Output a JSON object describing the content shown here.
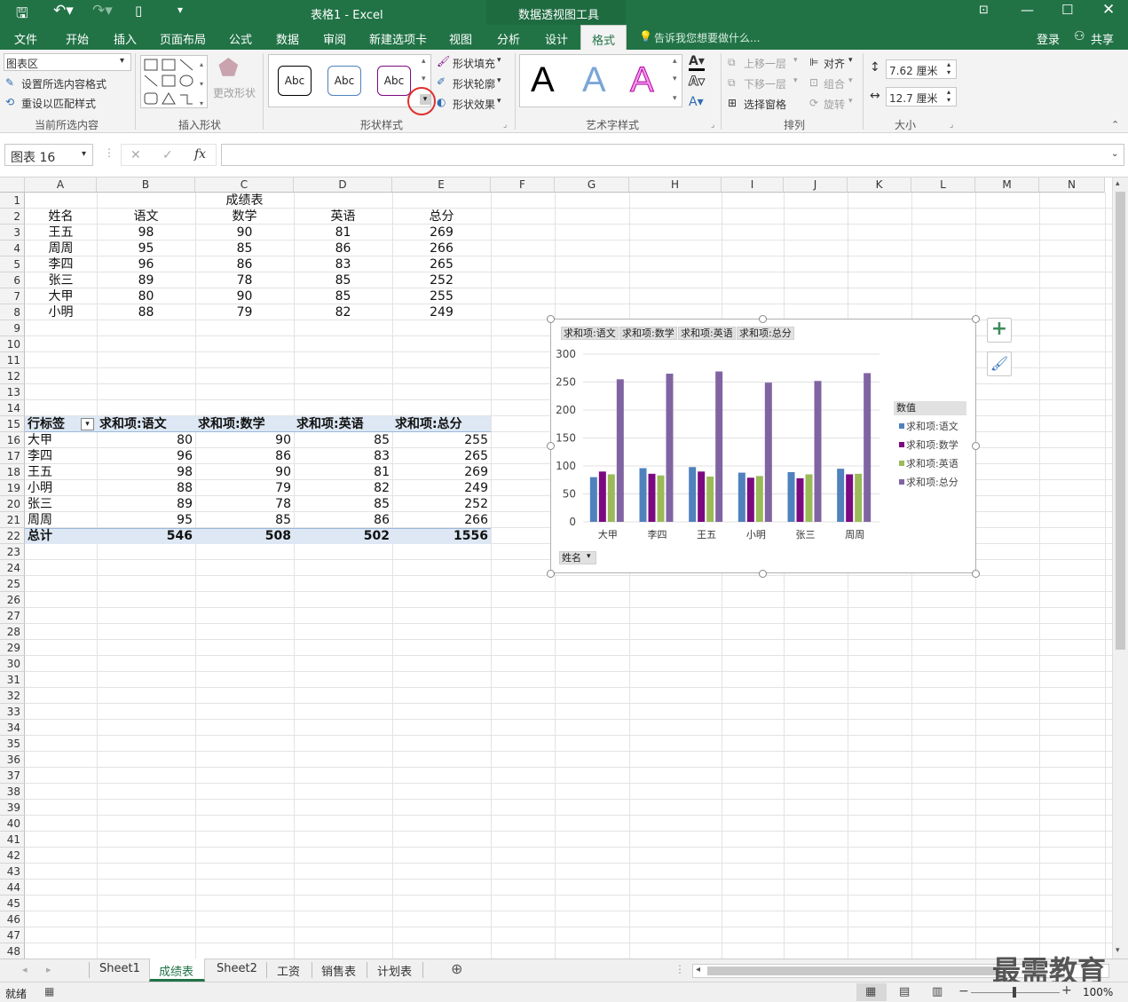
{
  "titlebar": {
    "title": "表格1 - Excel",
    "context_tool": "数据透视图工具"
  },
  "tabs": [
    "文件",
    "开始",
    "插入",
    "页面布局",
    "公式",
    "数据",
    "审阅",
    "新建选项卡",
    "视图",
    "分析",
    "设计",
    "格式"
  ],
  "tell_me": "告诉我您想要做什么...",
  "login": "登录",
  "share": "共享",
  "ribbon": {
    "selection_dropdown": "图表区",
    "format_selection": "设置所选内容格式",
    "reset_style": "重设以匹配样式",
    "group_current": "当前所选内容",
    "change_shape": "更改形状",
    "group_insert_shapes": "插入形状",
    "style_sample": "Abc",
    "shape_fill": "形状填充",
    "shape_outline": "形状轮廓",
    "shape_effects": "形状效果",
    "group_shape_styles": "形状样式",
    "wordart_letter": "A",
    "group_wordart": "艺术字样式",
    "bring_forward": "上移一层",
    "send_backward": "下移一层",
    "selection_pane": "选择窗格",
    "align": "对齐",
    "group": "组合",
    "rotate": "旋转",
    "group_arrange": "排列",
    "height": "7.62 厘米",
    "width": "12.7 厘米",
    "group_size": "大小"
  },
  "formula": {
    "namebox": "图表 16",
    "fx": "fx",
    "content": ""
  },
  "columns": [
    "A",
    "B",
    "C",
    "D",
    "E",
    "F",
    "G",
    "H",
    "I",
    "J",
    "K",
    "L",
    "M",
    "N"
  ],
  "table": {
    "title": "成绩表",
    "headers": [
      "姓名",
      "语文",
      "数学",
      "英语",
      "总分"
    ],
    "rows": [
      [
        "王五",
        "98",
        "90",
        "81",
        "269"
      ],
      [
        "周周",
        "95",
        "85",
        "86",
        "266"
      ],
      [
        "李四",
        "96",
        "86",
        "83",
        "265"
      ],
      [
        "张三",
        "89",
        "78",
        "85",
        "252"
      ],
      [
        "大甲",
        "80",
        "90",
        "85",
        "255"
      ],
      [
        "小明",
        "88",
        "79",
        "82",
        "249"
      ]
    ]
  },
  "pivot": {
    "headers": [
      "行标签",
      "求和项:语文",
      "求和项:数学",
      "求和项:英语",
      "求和项:总分"
    ],
    "rows": [
      [
        "大甲",
        "80",
        "90",
        "85",
        "255"
      ],
      [
        "李四",
        "96",
        "86",
        "83",
        "265"
      ],
      [
        "王五",
        "98",
        "90",
        "81",
        "269"
      ],
      [
        "小明",
        "88",
        "79",
        "82",
        "249"
      ],
      [
        "张三",
        "89",
        "78",
        "85",
        "252"
      ],
      [
        "周周",
        "95",
        "85",
        "86",
        "266"
      ]
    ],
    "total": [
      "总计",
      "546",
      "508",
      "502",
      "1556"
    ]
  },
  "chart_data": {
    "type": "bar",
    "categories": [
      "大甲",
      "李四",
      "王五",
      "小明",
      "张三",
      "周周"
    ],
    "series": [
      {
        "name": "求和项:语文",
        "values": [
          80,
          96,
          98,
          88,
          89,
          95
        ],
        "color": "#4f81bd"
      },
      {
        "name": "求和项:数学",
        "values": [
          90,
          86,
          90,
          79,
          78,
          85
        ],
        "color": "#7b0a81"
      },
      {
        "name": "求和项:英语",
        "values": [
          85,
          83,
          81,
          82,
          85,
          86
        ],
        "color": "#9bbb59"
      },
      {
        "name": "求和项:总分",
        "values": [
          255,
          265,
          269,
          249,
          252,
          266
        ],
        "color": "#8064a2"
      }
    ],
    "yticks": [
      "300",
      "250",
      "200",
      "150",
      "100",
      "50",
      "0"
    ],
    "ylim": [
      0,
      300
    ],
    "legend_title": "数值",
    "legend_position": "right",
    "axis_field": "姓名"
  },
  "sheets": [
    "Sheet1",
    "成绩表",
    "Sheet2",
    "工资",
    "销售表",
    "计划表"
  ],
  "status": {
    "ready": "就绪",
    "zoom": "100%"
  },
  "watermark": "最需教育"
}
